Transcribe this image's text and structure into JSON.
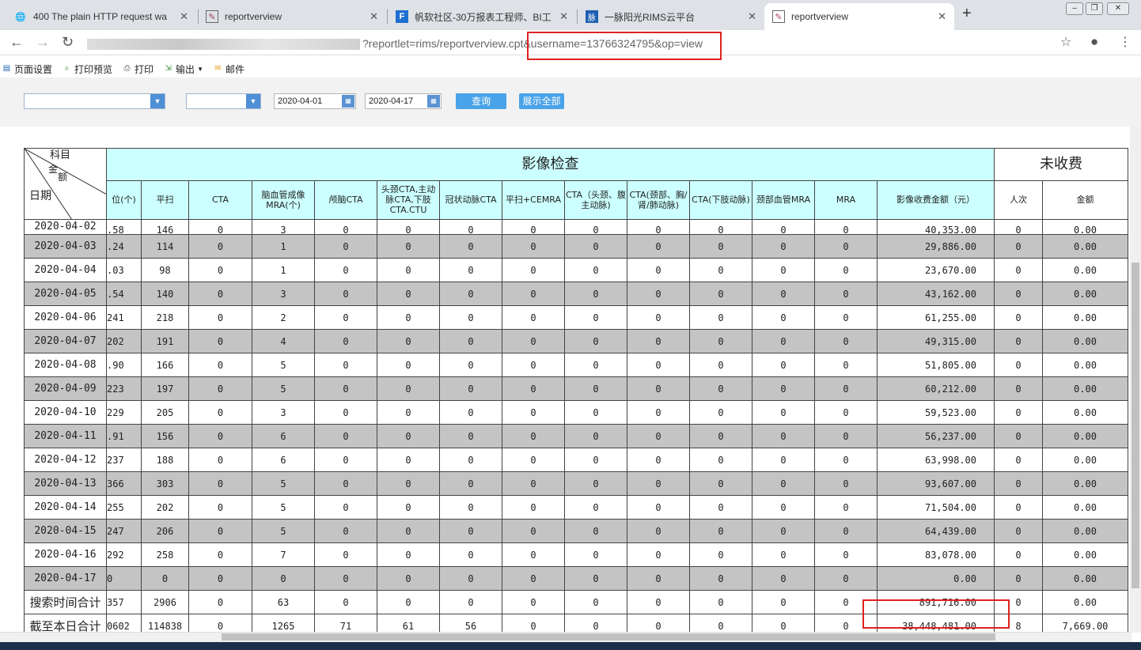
{
  "tabs": [
    {
      "title": "400 The plain HTTP request wa",
      "icon": "globe-icon"
    },
    {
      "title": "reportverview",
      "icon": "report-icon"
    },
    {
      "title": "帆软社区-30万报表工程师、BI工",
      "icon": "fanruan-icon"
    },
    {
      "title": "一脉阳光RIMS云平台",
      "icon": "rims-icon"
    },
    {
      "title": "reportverview",
      "icon": "report-icon"
    }
  ],
  "address": {
    "visible": "?reportlet=rims/reportverview.cpt&username=13766324795&op=view"
  },
  "report_toolbar": [
    "页面设置",
    "打印预览",
    "打印",
    "输出",
    "邮件"
  ],
  "params": {
    "date_from": "2020-04-01",
    "date_to": "2020-04-17",
    "query": "查询",
    "show_all": "展示全部"
  },
  "header": {
    "corner_top": "科目",
    "corner_mid1": "金",
    "corner_mid2": "额",
    "corner_bottom": "日期",
    "group1": "影像检查",
    "group2": "未收费",
    "columns": [
      "位(个)",
      "平扫",
      "CTA",
      "脑血管成像MRA(个)",
      "颅脑CTA",
      "头颈CTA,主动脉CTA,下肢CTA.CTU",
      "冠状动脉CTA",
      "平扫+CEMRA",
      "CTA（头颈、腹主动脉)",
      "CTA(颈部、胸/肾/肺动脉)",
      "CTA(下肢动脉)",
      "颈部血管MRA",
      "MRA",
      "影像收费金额（元）",
      "人次",
      "金额"
    ]
  },
  "rows": [
    {
      "date": "2020-04-02",
      "c": [
        ".58",
        "146",
        "0",
        "3",
        "0",
        "0",
        "0",
        "0",
        "0",
        "0",
        "0",
        "0",
        "0",
        "40,353.00",
        "0",
        "0.00"
      ]
    },
    {
      "date": "2020-04-03",
      "c": [
        ".24",
        "114",
        "0",
        "1",
        "0",
        "0",
        "0",
        "0",
        "0",
        "0",
        "0",
        "0",
        "0",
        "29,886.00",
        "0",
        "0.00"
      ]
    },
    {
      "date": "2020-04-04",
      "c": [
        ".03",
        "98",
        "0",
        "1",
        "0",
        "0",
        "0",
        "0",
        "0",
        "0",
        "0",
        "0",
        "0",
        "23,670.00",
        "0",
        "0.00"
      ]
    },
    {
      "date": "2020-04-05",
      "c": [
        ".54",
        "140",
        "0",
        "3",
        "0",
        "0",
        "0",
        "0",
        "0",
        "0",
        "0",
        "0",
        "0",
        "43,162.00",
        "0",
        "0.00"
      ]
    },
    {
      "date": "2020-04-06",
      "c": [
        "241",
        "218",
        "0",
        "2",
        "0",
        "0",
        "0",
        "0",
        "0",
        "0",
        "0",
        "0",
        "0",
        "61,255.00",
        "0",
        "0.00"
      ]
    },
    {
      "date": "2020-04-07",
      "c": [
        "202",
        "191",
        "0",
        "4",
        "0",
        "0",
        "0",
        "0",
        "0",
        "0",
        "0",
        "0",
        "0",
        "49,315.00",
        "0",
        "0.00"
      ]
    },
    {
      "date": "2020-04-08",
      "c": [
        ".90",
        "166",
        "0",
        "5",
        "0",
        "0",
        "0",
        "0",
        "0",
        "0",
        "0",
        "0",
        "0",
        "51,805.00",
        "0",
        "0.00"
      ]
    },
    {
      "date": "2020-04-09",
      "c": [
        "223",
        "197",
        "0",
        "5",
        "0",
        "0",
        "0",
        "0",
        "0",
        "0",
        "0",
        "0",
        "0",
        "60,212.00",
        "0",
        "0.00"
      ]
    },
    {
      "date": "2020-04-10",
      "c": [
        "229",
        "205",
        "0",
        "3",
        "0",
        "0",
        "0",
        "0",
        "0",
        "0",
        "0",
        "0",
        "0",
        "59,523.00",
        "0",
        "0.00"
      ]
    },
    {
      "date": "2020-04-11",
      "c": [
        ".91",
        "156",
        "0",
        "6",
        "0",
        "0",
        "0",
        "0",
        "0",
        "0",
        "0",
        "0",
        "0",
        "56,237.00",
        "0",
        "0.00"
      ]
    },
    {
      "date": "2020-04-12",
      "c": [
        "237",
        "188",
        "0",
        "6",
        "0",
        "0",
        "0",
        "0",
        "0",
        "0",
        "0",
        "0",
        "0",
        "63,998.00",
        "0",
        "0.00"
      ]
    },
    {
      "date": "2020-04-13",
      "c": [
        "366",
        "303",
        "0",
        "5",
        "0",
        "0",
        "0",
        "0",
        "0",
        "0",
        "0",
        "0",
        "0",
        "93,607.00",
        "0",
        "0.00"
      ]
    },
    {
      "date": "2020-04-14",
      "c": [
        "255",
        "202",
        "0",
        "5",
        "0",
        "0",
        "0",
        "0",
        "0",
        "0",
        "0",
        "0",
        "0",
        "71,504.00",
        "0",
        "0.00"
      ]
    },
    {
      "date": "2020-04-15",
      "c": [
        "247",
        "206",
        "0",
        "5",
        "0",
        "0",
        "0",
        "0",
        "0",
        "0",
        "0",
        "0",
        "0",
        "64,439.00",
        "0",
        "0.00"
      ]
    },
    {
      "date": "2020-04-16",
      "c": [
        "292",
        "258",
        "0",
        "7",
        "0",
        "0",
        "0",
        "0",
        "0",
        "0",
        "0",
        "0",
        "0",
        "83,078.00",
        "0",
        "0.00"
      ]
    },
    {
      "date": "2020-04-17",
      "c": [
        "0",
        "0",
        "0",
        "0",
        "0",
        "0",
        "0",
        "0",
        "0",
        "0",
        "0",
        "0",
        "0",
        "0.00",
        "0",
        "0.00"
      ]
    }
  ],
  "totals": [
    {
      "label": "搜索时间合计",
      "c": [
        "357",
        "2906",
        "0",
        "63",
        "0",
        "0",
        "0",
        "0",
        "0",
        "0",
        "0",
        "0",
        "0",
        "891,716.00",
        "0",
        "0.00"
      ]
    },
    {
      "label": "截至本日合计",
      "c": [
        "0602",
        "114838",
        "0",
        "1265",
        "71",
        "61",
        "56",
        "0",
        "0",
        "0",
        "0",
        "0",
        "0",
        "38,448,481.00",
        "8",
        "7,669.00"
      ]
    }
  ],
  "colors": {
    "header_fill": "#ccffff",
    "stripe": "#c4c4c4",
    "highlight": "#e02020",
    "button": "#4aa3e8"
  }
}
